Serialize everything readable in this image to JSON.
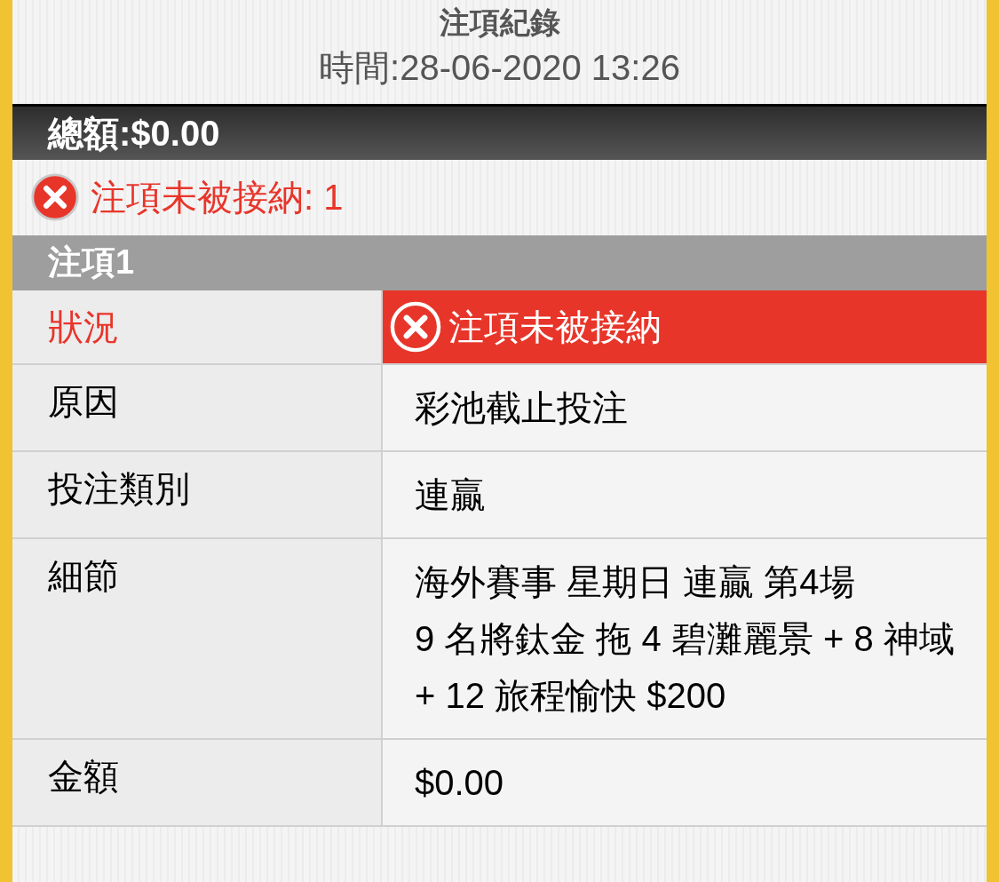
{
  "title": "注項紀錄",
  "time": "時間:28-06-2020 13:26",
  "total": "總額:$0.00",
  "error_summary": "注項未被接納: 1",
  "bet": {
    "heading": "注項1",
    "rows": [
      {
        "kind": "status",
        "label": "狀況",
        "value": [
          "注項未被接納"
        ]
      },
      {
        "kind": "text",
        "label": "原因",
        "value": [
          "彩池截止投注"
        ]
      },
      {
        "kind": "text",
        "label": "投注類別",
        "value": [
          "連贏"
        ]
      },
      {
        "kind": "text",
        "label": "細節",
        "value": [
          "海外賽事 星期日 連贏 第4場",
          "9 名將鈦金 拖 4 碧灘麗景 + 8 神域 + 12 旅程愉快 $200"
        ]
      },
      {
        "kind": "text",
        "label": "金額",
        "value": [
          "$0.00"
        ]
      }
    ]
  }
}
